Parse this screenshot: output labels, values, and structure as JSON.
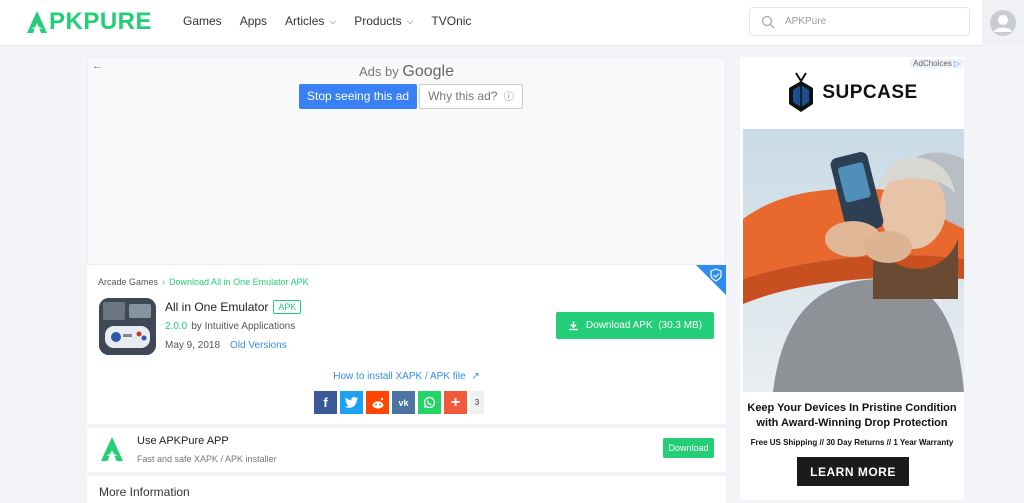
{
  "brand": {
    "logo_text": "PKPURE",
    "accent": "#24cd77"
  },
  "nav": {
    "items": [
      "Games",
      "Apps",
      "Articles",
      "Products",
      "TVOnic"
    ]
  },
  "search": {
    "placeholder": "APKPure"
  },
  "ad_top": {
    "ads_by_label": "Ads by",
    "google": "Google",
    "stop_label": "Stop seeing this ad",
    "why_label": "Why this ad?"
  },
  "breadcrumb": {
    "category": "Arcade Games",
    "current": "Download All in One Emulator APK"
  },
  "app": {
    "name": "All in One Emulator",
    "tag": "APK",
    "version": "2.0.0",
    "developer": "by Intuitive Applications",
    "date": "May 9, 2018",
    "old_versions": "Old Versions",
    "download_label": "Download APK",
    "size": "(30.3 MB)",
    "howto": "How to install XAPK / APK file"
  },
  "share": {
    "count": "3",
    "icons": [
      "facebook-icon",
      "twitter-icon",
      "reddit-icon",
      "vk-icon",
      "whatsapp-icon",
      "plus-icon"
    ]
  },
  "promo": {
    "title": "Use APKPure APP",
    "subtitle": "Fast and safe XAPK / APK installer",
    "button": "Download"
  },
  "more_info": {
    "title": "More Information"
  },
  "side_ad": {
    "adchoices": "AdChoices",
    "brand": "SUPCASE",
    "tagline": "Keep Your Devices In Pristine Condition with Award-Winning Drop Protection",
    "sub": "Free US Shipping // 30 Day Returns // 1 Year Warranty",
    "cta": "LEARN MORE"
  }
}
